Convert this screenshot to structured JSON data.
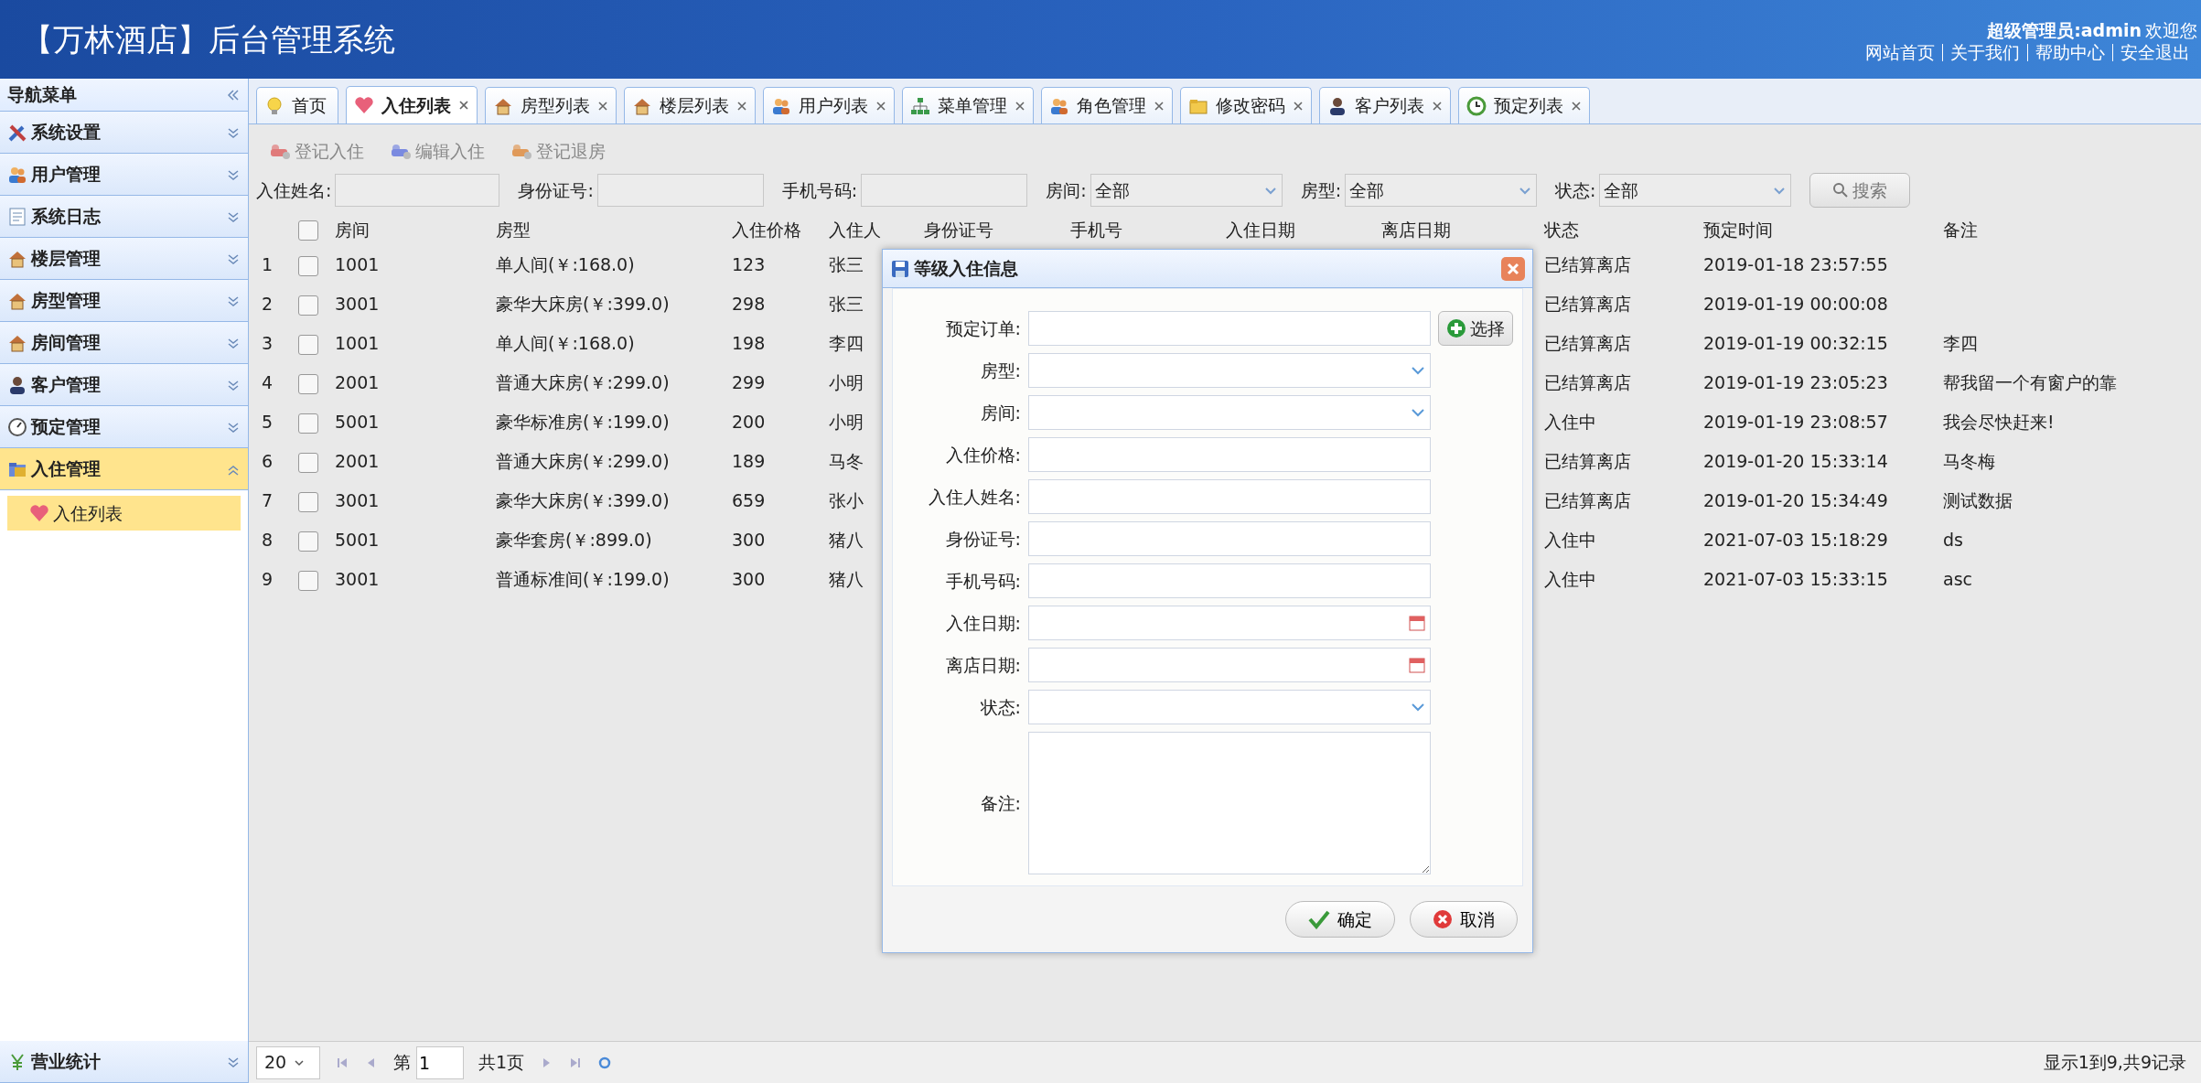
{
  "header": {
    "title": "【万林酒店】后台管理系统",
    "user": "超级管理员:admin",
    "welcome": "欢迎您",
    "links": [
      "网站首页",
      "关于我们",
      "帮助中心",
      "安全退出"
    ]
  },
  "sidebar": {
    "title": "导航菜单",
    "items": [
      {
        "label": "系统设置",
        "expanded": false,
        "selected": false
      },
      {
        "label": "用户管理",
        "expanded": false,
        "selected": false
      },
      {
        "label": "系统日志",
        "expanded": false,
        "selected": false
      },
      {
        "label": "楼层管理",
        "expanded": false,
        "selected": false
      },
      {
        "label": "房型管理",
        "expanded": false,
        "selected": false
      },
      {
        "label": "房间管理",
        "expanded": false,
        "selected": false
      },
      {
        "label": "客户管理",
        "expanded": false,
        "selected": false
      },
      {
        "label": "预定管理",
        "expanded": false,
        "selected": false
      },
      {
        "label": "入住管理",
        "expanded": true,
        "selected": true,
        "children": [
          {
            "label": "入住列表",
            "selected": true
          }
        ]
      }
    ],
    "bottom_item": {
      "label": "营业统计",
      "expanded": false
    }
  },
  "tabs": [
    {
      "label": "首页",
      "selected": false,
      "closable": false
    },
    {
      "label": "入住列表",
      "selected": true,
      "closable": true
    },
    {
      "label": "房型列表",
      "selected": false,
      "closable": true
    },
    {
      "label": "楼层列表",
      "selected": false,
      "closable": true
    },
    {
      "label": "用户列表",
      "selected": false,
      "closable": true
    },
    {
      "label": "菜单管理",
      "selected": false,
      "closable": true
    },
    {
      "label": "角色管理",
      "selected": false,
      "closable": true
    },
    {
      "label": "修改密码",
      "selected": false,
      "closable": true
    },
    {
      "label": "客户列表",
      "selected": false,
      "closable": true
    },
    {
      "label": "预定列表",
      "selected": false,
      "closable": true
    }
  ],
  "toolbar": [
    "登记入住",
    "编辑入住",
    "登记退房"
  ],
  "filters": [
    {
      "kind": "text",
      "label": "入住姓名:"
    },
    {
      "kind": "text",
      "label": "身份证号:"
    },
    {
      "kind": "text",
      "label": "手机号码:"
    },
    {
      "kind": "select",
      "label": "房间:",
      "value": "全部"
    },
    {
      "kind": "select",
      "label": "房型:",
      "value": "全部"
    },
    {
      "kind": "select",
      "label": "状态:",
      "value": "全部"
    }
  ],
  "search_button": "搜索",
  "table": {
    "header_checked": false,
    "columns": [
      "房间",
      "房型",
      "入住价格",
      "入住人",
      "身份证号",
      "手机号",
      "入住日期",
      "离店日期",
      "状态",
      "预定时间",
      "备注"
    ],
    "rows": [
      {
        "index": "1",
        "checked": false,
        "room": "1001",
        "room_type": "单人间(￥:168.0)",
        "price": "123",
        "guest": "张三",
        "status": "已结算离店",
        "booked_at": "2019-01-18 23:57:55"
      },
      {
        "index": "2",
        "checked": false,
        "room": "3001",
        "room_type": "豪华大床房(￥:399.0)",
        "price": "298",
        "guest": "张三",
        "status": "已结算离店",
        "booked_at": "2019-01-19 00:00:08"
      },
      {
        "index": "3",
        "checked": false,
        "room": "1001",
        "room_type": "单人间(￥:168.0)",
        "price": "198",
        "guest": "李四",
        "status": "已结算离店",
        "booked_at": "2019-01-19 00:32:15",
        "note": "李四"
      },
      {
        "index": "4",
        "checked": false,
        "room": "2001",
        "room_type": "普通大床房(￥:299.0)",
        "price": "299",
        "guest": "小明",
        "status": "已结算离店",
        "booked_at": "2019-01-19 23:05:23",
        "note": "帮我留一个有窗户的靠"
      },
      {
        "index": "5",
        "checked": false,
        "room": "5001",
        "room_type": "豪华标准房(￥:199.0)",
        "price": "200",
        "guest": "小明",
        "status": "入住中",
        "booked_at": "2019-01-19 23:08:57",
        "note": "我会尽快赶来!"
      },
      {
        "index": "6",
        "checked": false,
        "room": "2001",
        "room_type": "普通大床房(￥:299.0)",
        "price": "189",
        "guest": "马冬",
        "status": "已结算离店",
        "booked_at": "2019-01-20 15:33:14",
        "note": "马冬梅"
      },
      {
        "index": "7",
        "checked": false,
        "room": "3001",
        "room_type": "豪华大床房(￥:399.0)",
        "price": "659",
        "guest": "张小",
        "status": "已结算离店",
        "booked_at": "2019-01-20 15:34:49",
        "note": "测试数据"
      },
      {
        "index": "8",
        "checked": false,
        "room": "5001",
        "room_type": "豪华套房(￥:899.0)",
        "price": "300",
        "guest": "猪八",
        "status": "入住中",
        "booked_at": "2021-07-03 15:18:29",
        "note": "ds"
      },
      {
        "index": "9",
        "checked": false,
        "room": "3001",
        "room_type": "普通标准间(￥:199.0)",
        "price": "300",
        "guest": "猪八",
        "status": "入住中",
        "booked_at": "2021-07-03 15:33:15",
        "note": "asc"
      }
    ]
  },
  "dialog": {
    "title": "等级入住信息",
    "fields": [
      {
        "kind": "text",
        "label": "预定订单:",
        "button": "选择"
      },
      {
        "kind": "select",
        "label": "房型:"
      },
      {
        "kind": "select",
        "label": "房间:"
      },
      {
        "kind": "text",
        "label": "入住价格:"
      },
      {
        "kind": "text",
        "label": "入住人姓名:"
      },
      {
        "kind": "text",
        "label": "身份证号:"
      },
      {
        "kind": "text",
        "label": "手机号码:"
      },
      {
        "kind": "date",
        "label": "入住日期:"
      },
      {
        "kind": "date",
        "label": "离店日期:"
      },
      {
        "kind": "select",
        "label": "状态:"
      },
      {
        "kind": "textarea",
        "label": "备注:"
      }
    ],
    "buttons": [
      {
        "kind": "ok",
        "label": "确定"
      },
      {
        "kind": "cancel",
        "label": "取消"
      }
    ]
  },
  "pagination": {
    "page_size": "20",
    "page_prefix": "第",
    "page": "1",
    "total_pages": "共1页",
    "summary": "显示1到9,共9记录"
  }
}
